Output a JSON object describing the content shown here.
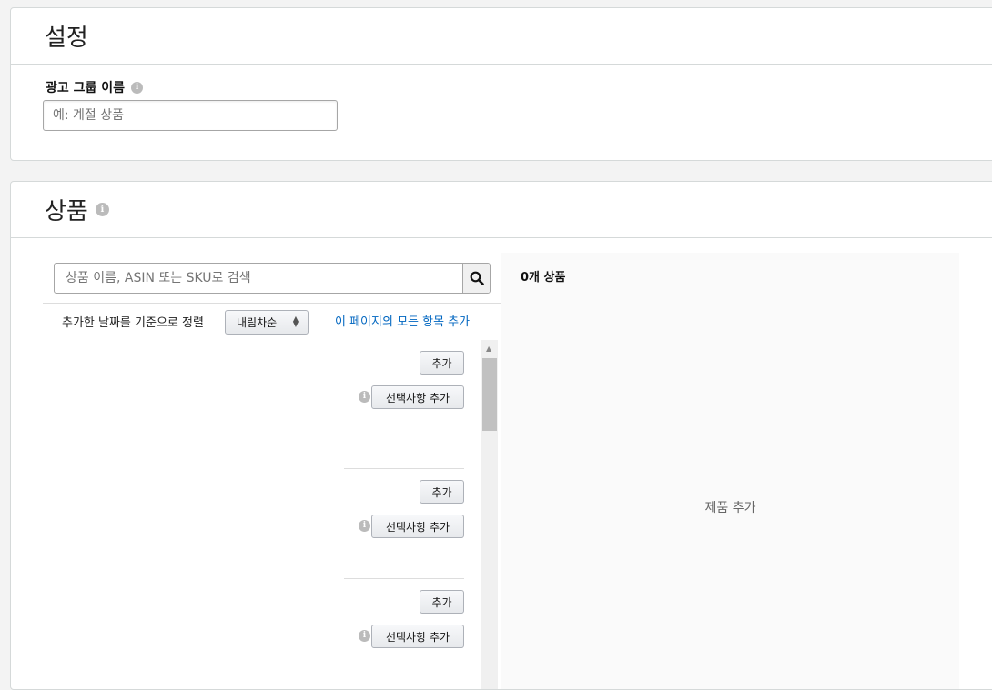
{
  "settings": {
    "title": "설정",
    "ad_group_name_label": "광고 그룹 이름",
    "ad_group_name_placeholder": "예: 계절 상품",
    "ad_group_name_value": ""
  },
  "products": {
    "title": "상품",
    "search_placeholder": "상품 이름, ASIN 또는 SKU로 검색",
    "search_icon": "search-icon",
    "sort_label": "추가한 날짜를 기준으로 정렬",
    "sort_selected": "내림차순",
    "add_all_link": "이 페이지의 모든 항목 추가",
    "items": [
      {
        "add_label": "추가",
        "add_options_label": "선택사항 추가"
      },
      {
        "add_label": "추가",
        "add_options_label": "선택사항 추가"
      },
      {
        "add_label": "추가",
        "add_options_label": "선택사항 추가"
      }
    ],
    "selected_count_label": "0개 상품",
    "empty_state": "제품 추가"
  },
  "colors": {
    "link": "#0066c0",
    "border": "#d5d9d9",
    "background": "#f3f3f3"
  }
}
